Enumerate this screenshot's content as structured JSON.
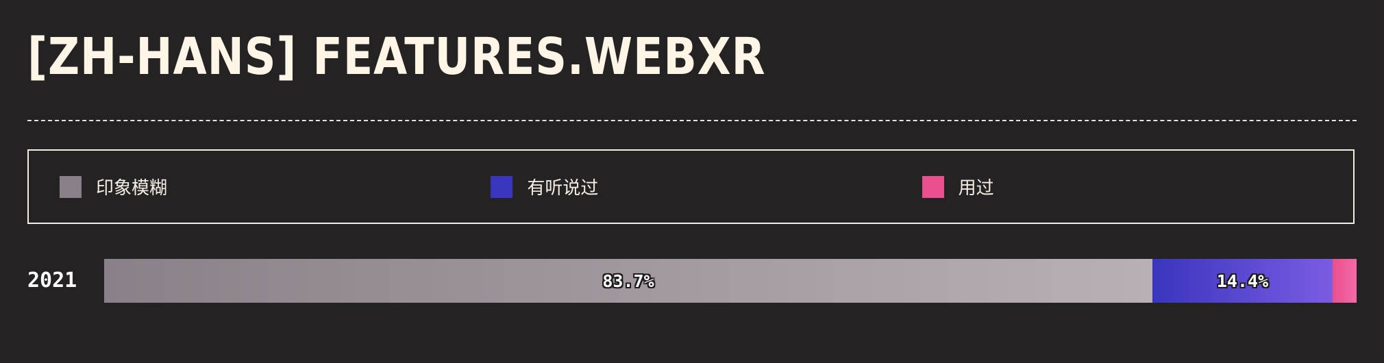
{
  "title": "[ZH-HANS] FEATURES.WEBXR",
  "legend": [
    {
      "label": "印象模糊",
      "color": "#8a8089"
    },
    {
      "label": "有听说过",
      "color": "#3a35be"
    },
    {
      "label": "用过",
      "color": "#ea4f8e"
    }
  ],
  "chart_data": {
    "type": "bar",
    "orientation": "horizontal-stacked",
    "title": "[ZH-HANS] FEATURES.WEBXR",
    "categories": [
      "2021"
    ],
    "series": [
      {
        "name": "印象模糊",
        "values": [
          83.7
        ],
        "label": "83.7%",
        "gradient": [
          "#8a8089",
          "#b8b0b4"
        ]
      },
      {
        "name": "有听说过",
        "values": [
          14.4
        ],
        "label": "14.4%",
        "gradient": [
          "#3a35be",
          "#7b5ce3"
        ]
      },
      {
        "name": "用过",
        "values": [
          1.9
        ],
        "label": "",
        "gradient": [
          "#ea4f8e",
          "#f26aa6"
        ]
      }
    ],
    "xlim": [
      0,
      100
    ],
    "legend_position": "top",
    "grid": false
  }
}
